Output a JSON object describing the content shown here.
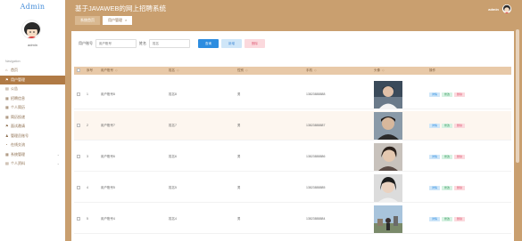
{
  "brand": "Admin",
  "sidebar": {
    "username": "admin",
    "nav_heading": "Navigation",
    "items": [
      {
        "icon": "home-icon",
        "glyph": "⌂",
        "label": "首页"
      },
      {
        "icon": "flag-icon",
        "glyph": "⚑",
        "label": "用户管理"
      },
      {
        "icon": "document-icon",
        "glyph": "▤",
        "label": "公告"
      },
      {
        "icon": "grid-icon",
        "glyph": "▦",
        "label": "招聘信息"
      },
      {
        "icon": "grid-icon",
        "glyph": "▦",
        "label": "个人简历"
      },
      {
        "icon": "grid-icon",
        "glyph": "▦",
        "label": "简历投递"
      },
      {
        "icon": "flag-icon",
        "glyph": "⚑",
        "label": "面试邀请"
      },
      {
        "icon": "user-icon",
        "glyph": "♟",
        "label": "管理员账号"
      },
      {
        "icon": "chart-icon",
        "glyph": "◔",
        "label": "在线交流"
      },
      {
        "icon": "grid-icon",
        "glyph": "▦",
        "label": "系统管理"
      },
      {
        "icon": "document-icon",
        "glyph": "▤",
        "label": "个人资料"
      }
    ]
  },
  "header": {
    "title": "基于JAVAWEB的网上招聘系统",
    "admin_label": "admin",
    "tabs": [
      {
        "label": "系统首页"
      },
      {
        "label": "用户管理",
        "close": "×"
      }
    ]
  },
  "search": {
    "account_label": "用户账号",
    "account_placeholder": "用户账号",
    "name_label": "姓名",
    "name_placeholder": "姓名",
    "search_btn": "查询",
    "add_btn": "新增",
    "delete_btn": "删除"
  },
  "table": {
    "headers": [
      "",
      "序号",
      "用户账号",
      "姓名",
      "性别",
      "手机",
      "头像",
      "操作"
    ],
    "sort_glyph": "◇",
    "rows": [
      {
        "no": "1",
        "account": "用户账号8",
        "name": "姓名8",
        "sex": "男",
        "phone": "13823888888"
      },
      {
        "no": "2",
        "account": "用户账号7",
        "name": "姓名7",
        "sex": "男",
        "phone": "13823888887"
      },
      {
        "no": "3",
        "account": "用户账号6",
        "name": "姓名6",
        "sex": "男",
        "phone": "13823888886"
      },
      {
        "no": "4",
        "account": "用户账号5",
        "name": "姓名5",
        "sex": "男",
        "phone": "13823888885"
      },
      {
        "no": "5",
        "account": "用户账号4",
        "name": "姓名4",
        "sex": "男",
        "phone": "13823888884"
      }
    ],
    "ops": {
      "detail": "详情",
      "edit": "修改",
      "delete": "删除"
    }
  },
  "colors": {
    "accent": "#c99f6f",
    "active_nav": "#b07a45",
    "primary_button": "#2d8de0",
    "table_header": "#e8c9a8"
  }
}
